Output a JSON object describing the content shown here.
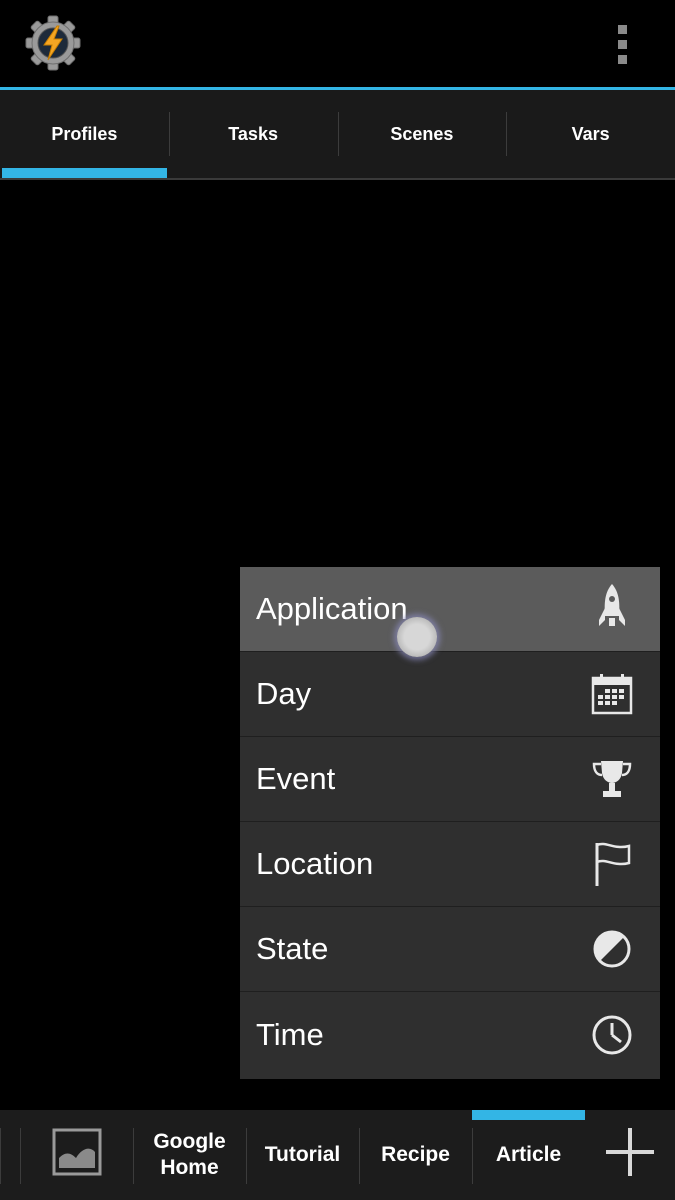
{
  "app": {
    "icon": "tasker-gear-bolt-icon",
    "accent_color": "#33b5e5"
  },
  "tabs": [
    {
      "label": "Profiles",
      "selected": true
    },
    {
      "label": "Tasks",
      "selected": false
    },
    {
      "label": "Scenes",
      "selected": false
    },
    {
      "label": "Vars",
      "selected": false
    }
  ],
  "menu": {
    "items": [
      {
        "label": "Application",
        "icon": "rocket-icon",
        "highlighted": true
      },
      {
        "label": "Day",
        "icon": "calendar-icon"
      },
      {
        "label": "Event",
        "icon": "trophy-icon"
      },
      {
        "label": "Location",
        "icon": "flag-icon"
      },
      {
        "label": "State",
        "icon": "half-circle-icon"
      },
      {
        "label": "Time",
        "icon": "clock-icon"
      }
    ]
  },
  "bottom_bar": {
    "image_icon": "image-icon",
    "projects": [
      {
        "label": "Google\nHome"
      },
      {
        "label": "Tutorial"
      },
      {
        "label": "Recipe"
      },
      {
        "label": "Article",
        "active": true
      }
    ],
    "add_icon": "plus-icon"
  }
}
